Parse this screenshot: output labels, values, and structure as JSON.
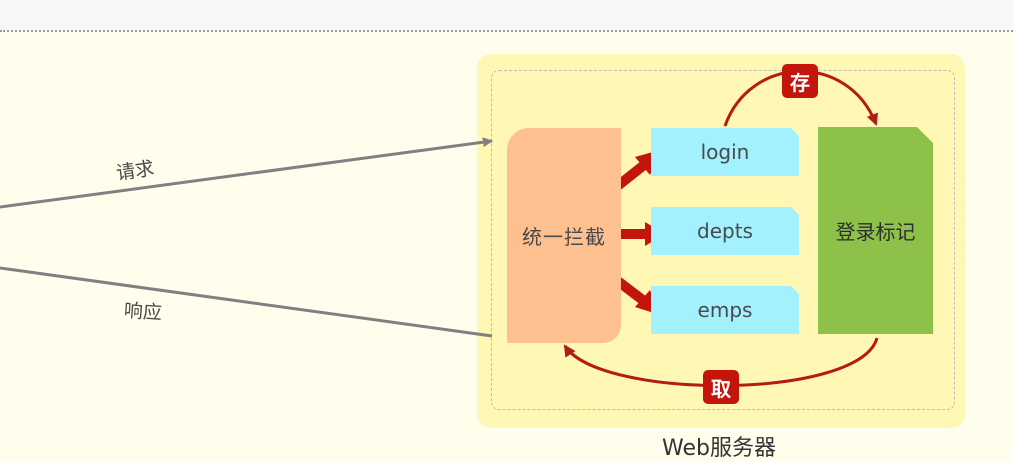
{
  "diagram": {
    "request_label": "请求",
    "response_label": "响应",
    "interceptor_label": "统一拦截",
    "resources": [
      "login",
      "depts",
      "emps"
    ],
    "flag_label": "登录标记",
    "store_label": "存",
    "fetch_label": "取",
    "server_caption": "Web服务器"
  },
  "colors": {
    "background": "#fffdeb",
    "server_box": "#fff7b3",
    "interceptor": "#fec08f",
    "resource": "#a3f1ff",
    "flag": "#8dc14a",
    "accent_red": "#c4150c",
    "line_gray": "#808080"
  }
}
